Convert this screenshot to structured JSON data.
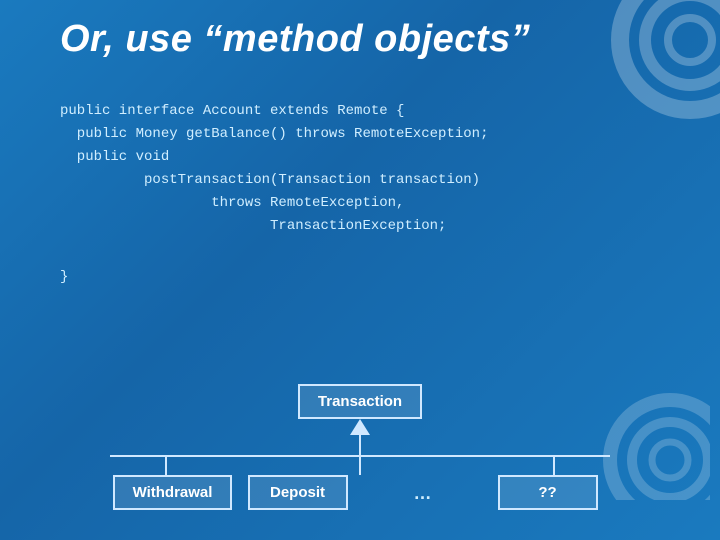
{
  "slide": {
    "title": "Or, use “method objects”",
    "code": {
      "lines": [
        "public interface Account extends Remote {",
        "  public Money getBalance() throws RemoteException;",
        "  public void",
        "          postTransaction(Transaction transaction)",
        "                  throws RemoteException,",
        "                         TransactionException;",
        "",
        "}"
      ]
    },
    "uml": {
      "top_box": "Transaction",
      "bottom_boxes": [
        {
          "label": "Withdrawal"
        },
        {
          "label": "Deposit"
        },
        {
          "label": "..."
        },
        {
          "label": "??"
        }
      ]
    }
  }
}
